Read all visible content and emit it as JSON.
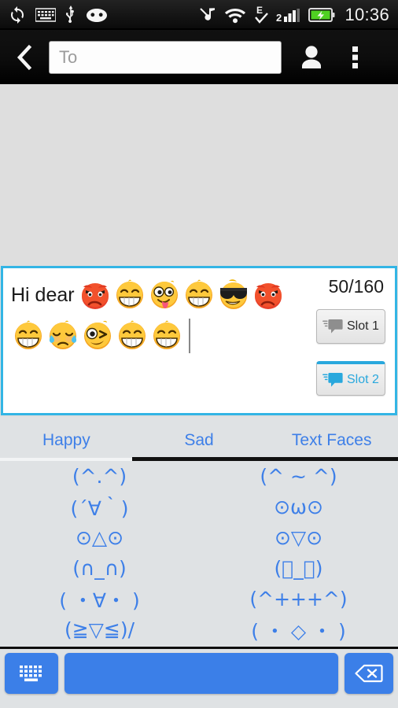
{
  "statusbar": {
    "time": "10:36",
    "left_icons": [
      "sync-icon",
      "keyboard-icon",
      "usb-icon",
      "android-head-icon"
    ],
    "right_icons": [
      "silent-mode-icon",
      "wifi-icon",
      "edge-network-icon",
      "signal-bars-icon",
      "battery-charging-icon"
    ]
  },
  "actionbar": {
    "back_icon": "back-chevron-icon",
    "recipient_value": "",
    "recipient_placeholder": "To",
    "contacts_icon": "contact-person-icon",
    "overflow_icon": "overflow-menu-icon"
  },
  "compose": {
    "message_text": "Hi dear",
    "char_count": "50/160",
    "emoji_row1": [
      "angry-red-face",
      "grinning-face",
      "tongue-out-face",
      "grinning-face",
      "sunglasses-face",
      "angry-red-face"
    ],
    "emoji_row2": [
      "grinning-face",
      "crying-face",
      "winking-face",
      "grinning-face",
      "grinning-face"
    ],
    "slot1_label": "Slot 1",
    "slot2_label": "Slot 2",
    "slot_icon": "sms-bubble-icon",
    "accent_border": "#33b5e5",
    "slot_active_color": "#29a8dd"
  },
  "tabs": {
    "items": [
      {
        "label": "Happy"
      },
      {
        "label": "Sad"
      },
      {
        "label": "Text Faces"
      }
    ],
    "active_index": 2,
    "text_color": "#3d7fe8"
  },
  "faces": {
    "items": [
      "(^.^)",
      "(^ ~ ^)",
      "(´∀｀)",
      "⊙ω⊙",
      "⊙△⊙",
      "⊙▽⊙",
      "(∩_∩)",
      "(ﾟ_ﾟ)",
      "( ・∀・ )",
      "(^+++^)",
      "(≧▽≦)/",
      "( ・ ◇ ・ )"
    ],
    "text_color": "#3d7fe8"
  },
  "keyboard_bar": {
    "keyboard_key_icon": "keyboard-icon",
    "space_key_label": "",
    "delete_key_icon": "backspace-icon",
    "key_color": "#3b7fe8"
  }
}
